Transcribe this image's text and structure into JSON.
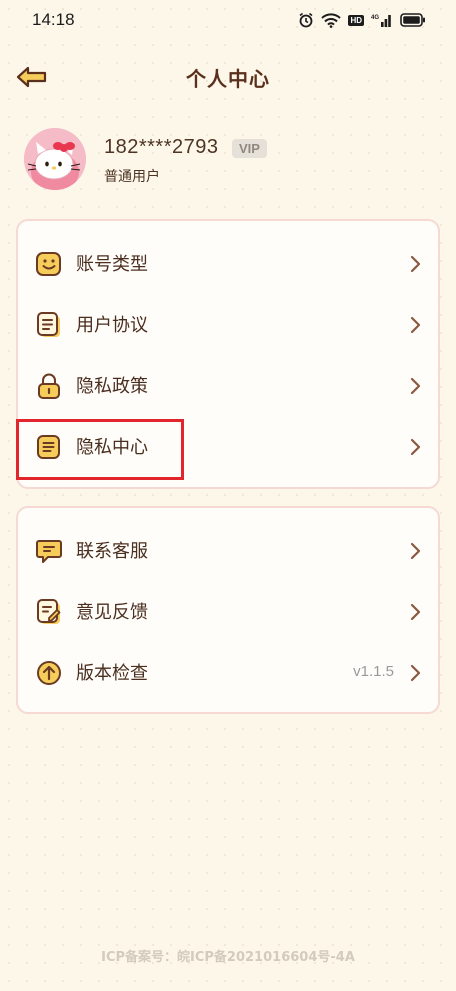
{
  "status_bar": {
    "time": "14:18",
    "icons": [
      "alarm-icon",
      "wifi-icon",
      "hd-badge",
      "signal-icon",
      "battery-icon"
    ],
    "hd_label": "HD",
    "signal_label": "4G"
  },
  "nav": {
    "title": "个人中心",
    "back_icon": "back-arrow-icon"
  },
  "profile": {
    "phone": "182****2793",
    "vip_label": "VIP",
    "user_type": "普通用户",
    "avatar": "hello-kitty-avatar"
  },
  "menu_group_1": [
    {
      "label": "账号类型",
      "icon": "smile-face-icon"
    },
    {
      "label": "用户协议",
      "icon": "document-icon"
    },
    {
      "label": "隐私政策",
      "icon": "lock-icon"
    },
    {
      "label": "隐私中心",
      "icon": "notes-icon"
    }
  ],
  "menu_group_2": [
    {
      "label": "联系客服",
      "icon": "chat-bubble-icon"
    },
    {
      "label": "意见反馈",
      "icon": "feedback-edit-icon"
    },
    {
      "label": "版本检查",
      "icon": "upgrade-arrow-icon",
      "value": "v1.1.5"
    }
  ],
  "footer": {
    "text": "ICP备案号：皖ICP备2021016604号-4A"
  },
  "colors": {
    "background": "#fdf7ea",
    "title": "#5a2f1c",
    "icon_fill": "#f6cd5b",
    "icon_stroke": "#6b3a22",
    "card_border": "#f5d9d2",
    "highlight": "#e2242c"
  }
}
